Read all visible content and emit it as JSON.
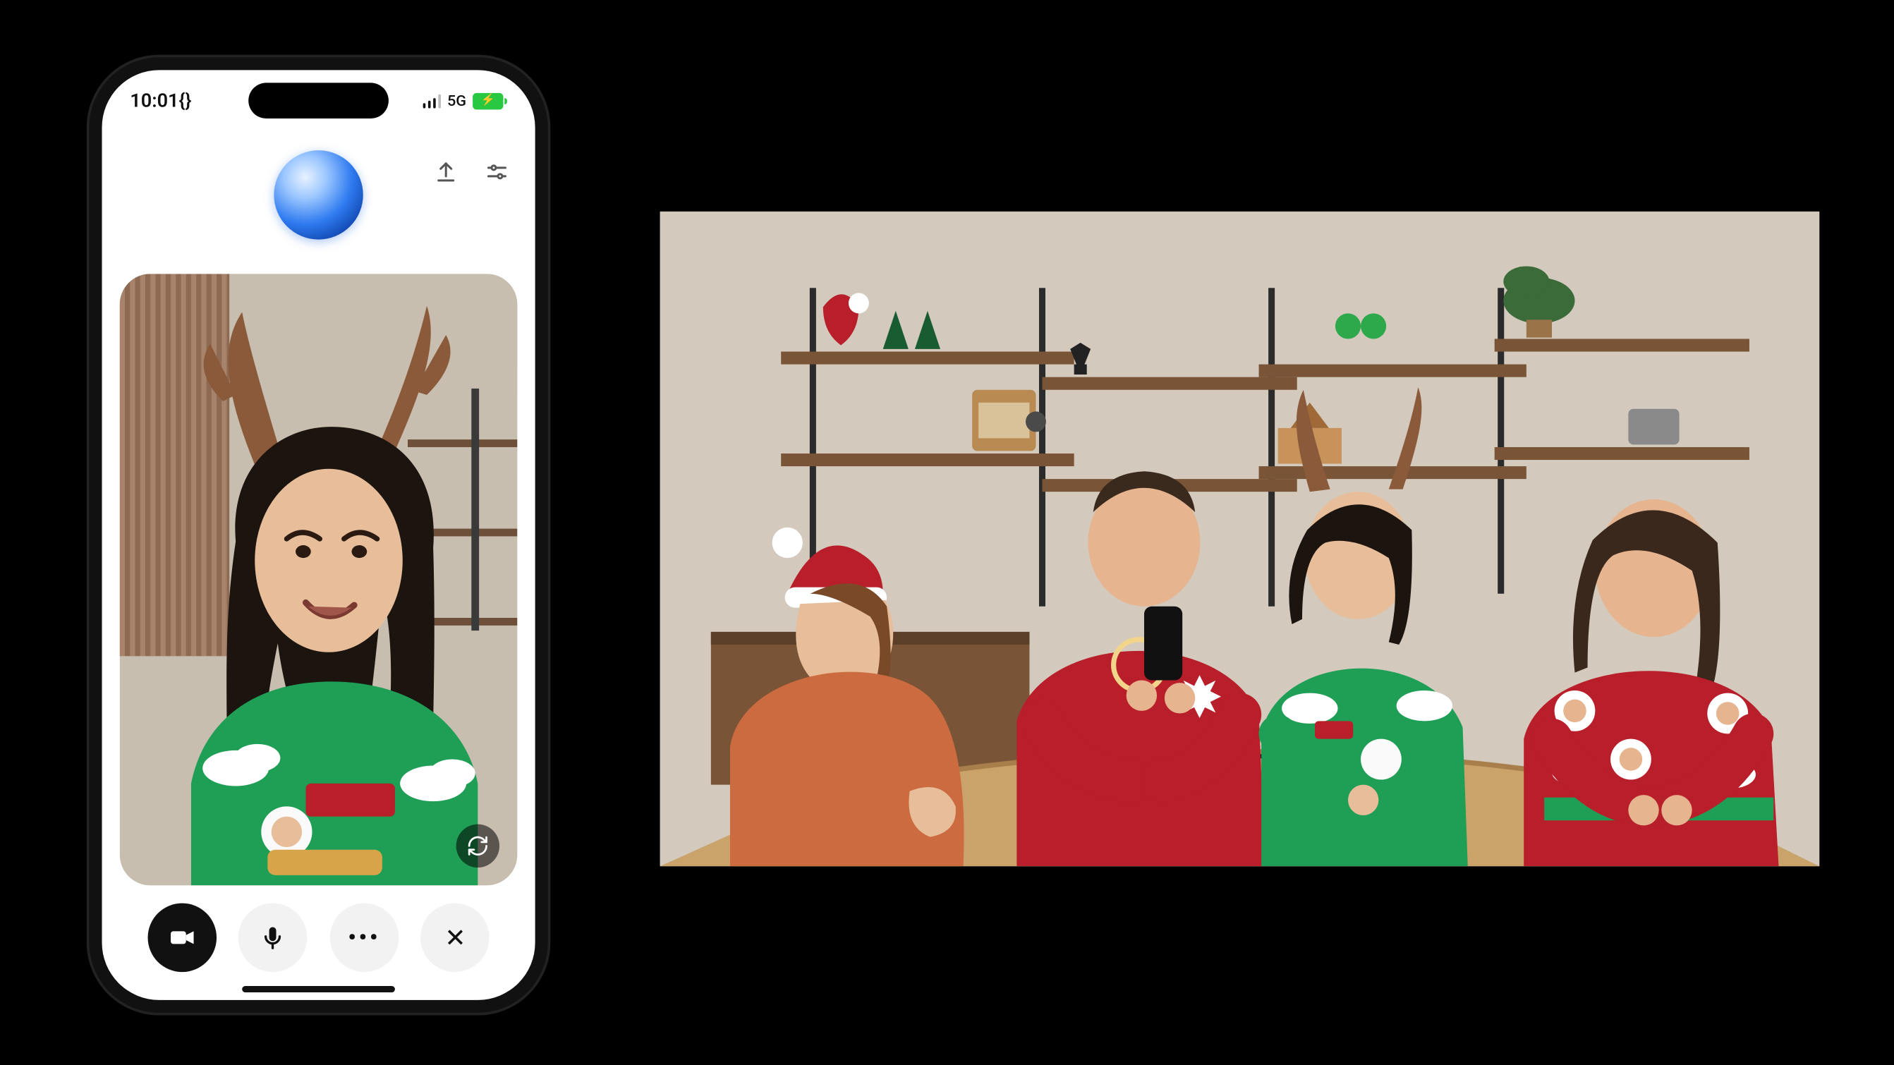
{
  "status_bar": {
    "time": "10:01{}",
    "network_label": "5G",
    "battery_glyph": "⚡"
  },
  "header": {
    "upload_icon": "upload-icon",
    "settings_icon": "settings-icon",
    "orb": "voice-orb"
  },
  "camera": {
    "flip_label": "flip-camera",
    "scene": "person-with-antlers-in-green-holiday-sweater"
  },
  "controls": {
    "video": "video",
    "mic": "mic",
    "more": "•••",
    "close": "✕"
  },
  "room_scene": {
    "description": "four-people-in-holiday-sweaters-at-wooden-table-with-shelves",
    "people_count": 4
  }
}
